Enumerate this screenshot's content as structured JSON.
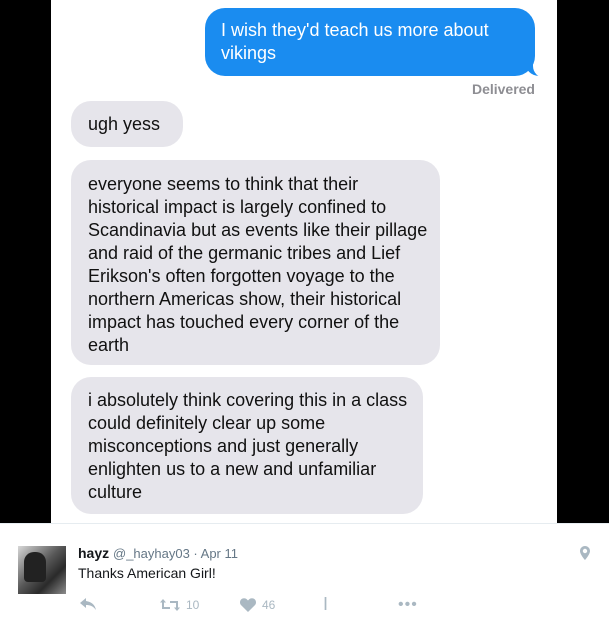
{
  "conversation": {
    "sent_message": "I wish they'd teach us more about vikings",
    "delivered_label": "Delivered",
    "received_messages": [
      "ugh yess",
      "everyone seems to think that their historical impact is largely confined to Scandinavia but as events like their pillage and raid of the germanic tribes and Lief Erikson's often forgotten voyage to the northern Americas show, their historical impact has touched every corner of the earth",
      "i absolutely think covering this in a class could definitely clear up some misconceptions and just generally enlighten us to a new and unfamiliar culture"
    ]
  },
  "tweet": {
    "display_name": "hayz",
    "meta": "@_hayhay03 · Apr 11",
    "text": "Thanks American Girl!",
    "retweet_count": "10",
    "like_count": "46",
    "icons": [
      "reply-icon",
      "retweet-icon",
      "like-icon",
      "more-icon",
      "location-pin-icon"
    ],
    "colors": {
      "sent_bubble": "#1a8cf0",
      "received_bubble": "#e6e5eb",
      "action_icons": "#aab8c2"
    }
  }
}
